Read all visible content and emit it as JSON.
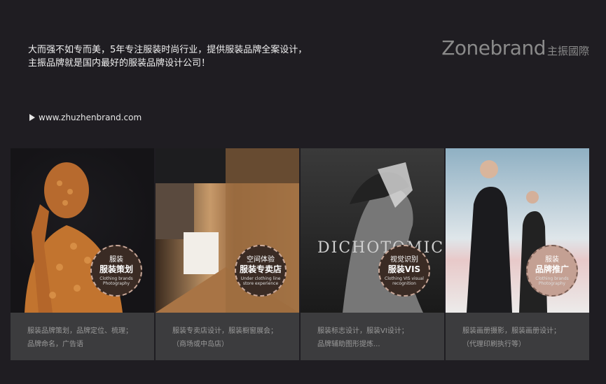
{
  "intro": {
    "line1": "大而强不如专而美，5年专注服装时尚行业，提供服装品牌全案设计，",
    "line2": "主振品牌就是国内最好的服装品牌设计公司！"
  },
  "brand": {
    "name": "Zonebrand",
    "cn": "主振國際"
  },
  "site": {
    "url": "www.zhuzhenbrand.com"
  },
  "cards": [
    {
      "badge_l1": "服装",
      "badge_l2": "服装策划",
      "badge_l3": "Clothing brands Photography",
      "desc1": "服装品牌策划，品牌定位、梳理；",
      "desc2": "品牌命名，广告语"
    },
    {
      "badge_l1": "空间体验",
      "badge_l2": "服装专卖店",
      "badge_l3": "Under clothing line store experience",
      "desc1": "服装专卖店设计，服装橱窗展会；",
      "desc2": "（商场或中岛店）"
    },
    {
      "badge_l1": "视觉识别",
      "badge_l2": "服装VIS",
      "badge_l3": "Clothing VIS visual recognition",
      "desc1": "服装标志设计，服装VI设计；",
      "desc2": "品牌辅助图形提炼...",
      "photo_text": "DICHOTOMIC"
    },
    {
      "badge_l1": "服装",
      "badge_l2": "品牌推广",
      "badge_l3": "Clothing brands Photography",
      "desc1": "服装画册摄影，服装画册设计；",
      "desc2": "（代理印刷执行等）"
    }
  ]
}
